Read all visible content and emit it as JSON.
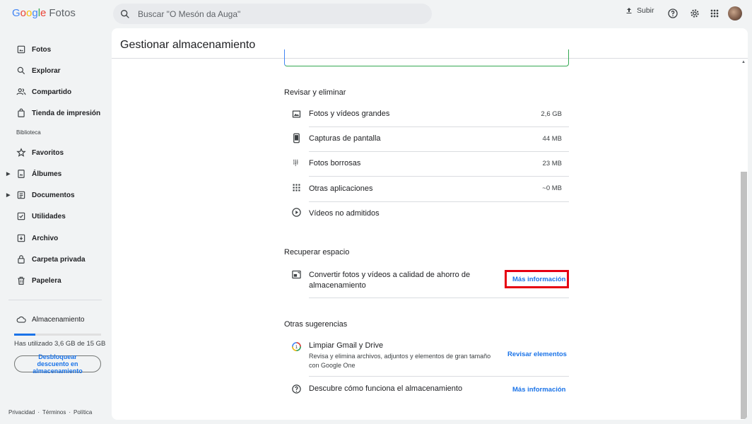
{
  "app": {
    "brand_letters": [
      "G",
      "o",
      "o",
      "g",
      "l",
      "e"
    ],
    "product": "Fotos"
  },
  "search": {
    "placeholder": "Buscar \"O Mesón da Auga\""
  },
  "topbar": {
    "upload_label": "Subir"
  },
  "sidebar": {
    "items": [
      {
        "label": "Fotos",
        "icon": "photo-icon"
      },
      {
        "label": "Explorar",
        "icon": "search-icon"
      },
      {
        "label": "Compartido",
        "icon": "people-icon"
      },
      {
        "label": "Tienda de impresión",
        "icon": "shop-icon"
      }
    ],
    "library_label": "Biblioteca",
    "library_items": [
      {
        "label": "Favoritos",
        "icon": "star-icon"
      },
      {
        "label": "Álbumes",
        "icon": "album-icon"
      },
      {
        "label": "Documentos",
        "icon": "document-icon"
      },
      {
        "label": "Utilidades",
        "icon": "utilities-icon"
      },
      {
        "label": "Archivo",
        "icon": "archive-icon"
      },
      {
        "label": "Carpeta privada",
        "icon": "lock-icon"
      },
      {
        "label": "Papelera",
        "icon": "trash-icon"
      }
    ],
    "storage_label": "Almacenamiento",
    "storage_used_text": "Has utilizado 3,6 GB de 15 GB",
    "storage_fraction": 0.24,
    "unlock_button": "Desbloquear descuento en almacenamiento",
    "footer": [
      "Privacidad",
      "·",
      "Términos",
      "·",
      "Política"
    ]
  },
  "main": {
    "title": "Gestionar almacenamiento",
    "review": {
      "title": "Revisar y eliminar",
      "rows": [
        {
          "label": "Fotos y vídeos grandes",
          "size": "2,6 GB",
          "icon": "large-media-icon"
        },
        {
          "label": "Capturas de pantalla",
          "size": "44 MB",
          "icon": "phone-screenshot-icon"
        },
        {
          "label": "Fotos borrosas",
          "size": "23 MB",
          "icon": "blur-icon"
        },
        {
          "label": "Otras aplicaciones",
          "size": "~0 MB",
          "icon": "apps-grid-icon"
        },
        {
          "label": "Vídeos no admitidos",
          "size": "",
          "icon": "play-circle-icon"
        }
      ]
    },
    "recover": {
      "title": "Recuperar espacio",
      "row_label": "Convertir fotos y vídeos a calidad de ahorro de almacenamiento",
      "action": "Más información"
    },
    "other": {
      "title": "Otras sugerencias",
      "gmail_title": "Limpiar Gmail y Drive",
      "gmail_sub": "Revisa y elimina archivos, adjuntos y elementos de gran tamaño con Google One",
      "gmail_action": "Revisar elementos",
      "learn_title": "Descubre cómo funciona el almacenamiento",
      "learn_action": "Más información"
    }
  },
  "colors": {
    "accent": "#1a73e8",
    "highlight": "#e60012"
  }
}
